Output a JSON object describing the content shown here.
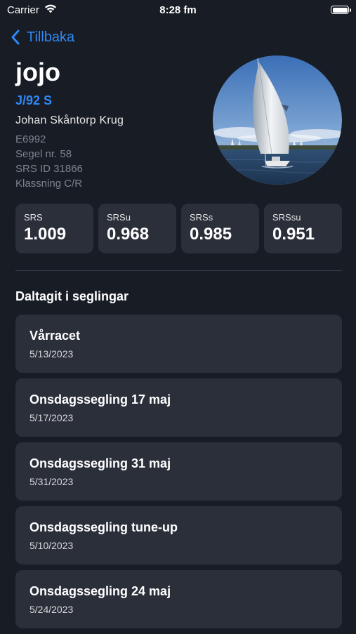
{
  "status": {
    "carrier": "Carrier",
    "time": "8:28 fm"
  },
  "nav": {
    "back_label": "Tillbaka"
  },
  "boat": {
    "name": "jojo",
    "type": "J/92 S",
    "owner": "Johan  Skåntorp Krug",
    "sail_id": "E6992",
    "sail_no": "Segel nr. 58",
    "srs_id": "SRS ID 31866",
    "class": "Klassning C/R"
  },
  "srs": [
    {
      "label": "SRS",
      "value": "1.009"
    },
    {
      "label": "SRSu",
      "value": "0.968"
    },
    {
      "label": "SRSs",
      "value": "0.985"
    },
    {
      "label": "SRSsu",
      "value": "0.951"
    }
  ],
  "section_title": "Daltagit i seglingar",
  "races": [
    {
      "name": "Vårracet",
      "date": "5/13/2023"
    },
    {
      "name": "Onsdagssegling 17 maj",
      "date": "5/17/2023"
    },
    {
      "name": "Onsdagssegling 31 maj",
      "date": "5/31/2023"
    },
    {
      "name": "Onsdagssegling tune-up",
      "date": "5/10/2023"
    },
    {
      "name": "Onsdagssegling 24 maj",
      "date": "5/24/2023"
    }
  ],
  "colors": {
    "accent": "#2f88f5",
    "background": "#181c25",
    "card": "#2a2f3a"
  }
}
